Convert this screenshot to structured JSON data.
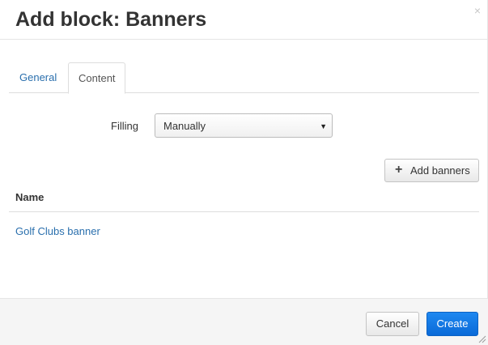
{
  "dialog": {
    "title": "Add block: Banners",
    "close_icon": "close-icon",
    "close_glyph": "×"
  },
  "tabs": [
    {
      "label": "General",
      "active": false
    },
    {
      "label": "Content",
      "active": true
    }
  ],
  "form": {
    "filling_label": "Filling",
    "filling_value": "Manually",
    "dropdown_glyph": "▼"
  },
  "toolbar": {
    "add_banners_icon": "plus-icon",
    "add_banners_glyph": "+",
    "add_banners_label": "Add banners"
  },
  "table": {
    "columns": [
      "Name"
    ],
    "rows": [
      {
        "name": "Golf Clubs banner"
      }
    ]
  },
  "footer": {
    "cancel_label": "Cancel",
    "create_label": "Create"
  },
  "colors": {
    "link": "#2a6fad",
    "primary": "#0a6ad8",
    "footer_bg": "#f5f5f5"
  }
}
